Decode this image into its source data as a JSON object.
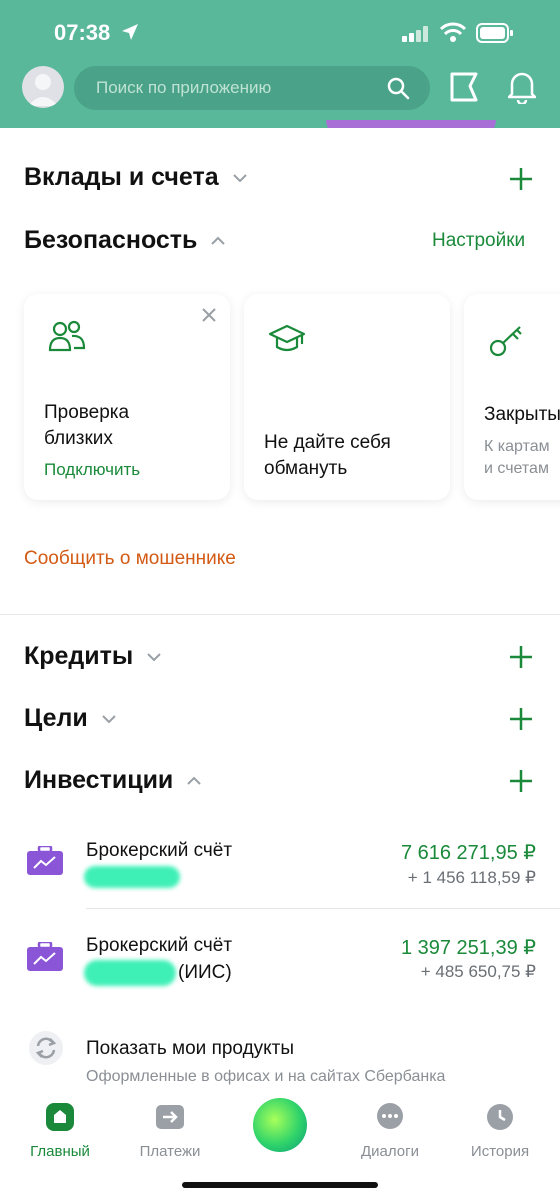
{
  "status_bar": {
    "time": "07:38"
  },
  "search": {
    "placeholder": "Поиск по приложению"
  },
  "sections": {
    "deposits": "Вклады и счета",
    "security": "Безопасность",
    "security_settings": "Настройки",
    "credits": "Кредиты",
    "goals": "Цели",
    "investments": "Инвестиции"
  },
  "security_cards": [
    {
      "title_line1": "Проверка",
      "title_line2": "близких",
      "link": "Подключить",
      "icon": "people-icon"
    },
    {
      "title_line1": "Не дайте себя",
      "title_line2": "обмануть",
      "icon": "graduation-cap-icon"
    },
    {
      "title": "Закрыты",
      "sub_line1": "К картам",
      "sub_line2": "и счетам",
      "icon": "key-icon"
    }
  ],
  "report_fraud": "Сообщить о мошеннике",
  "investments": [
    {
      "name": "Брокерский счёт",
      "sub": "",
      "amount": "7 616 271,95 ₽",
      "delta": "+ 1 456 118,59 ₽"
    },
    {
      "name": "Брокерский счёт",
      "sub": "(ИИС)",
      "amount": "1 397 251,39 ₽",
      "delta": "+ 485 650,75 ₽"
    }
  ],
  "show_products": {
    "title": "Показать мои продукты",
    "subtitle": "Оформленные в офисах и на сайтах Сбербанка"
  },
  "tabs": [
    {
      "label": "Главный",
      "icon": "home-icon",
      "active": true
    },
    {
      "label": "Платежи",
      "icon": "payments-icon"
    },
    {
      "label": "Диалоги",
      "icon": "chat-icon"
    },
    {
      "label": "История",
      "icon": "clock-icon"
    }
  ],
  "colors": {
    "header": "#5ab89a",
    "accent_green": "#1a8a3a",
    "report_orange": "#d35a14",
    "briefcase_purple": "#8a55d6"
  }
}
